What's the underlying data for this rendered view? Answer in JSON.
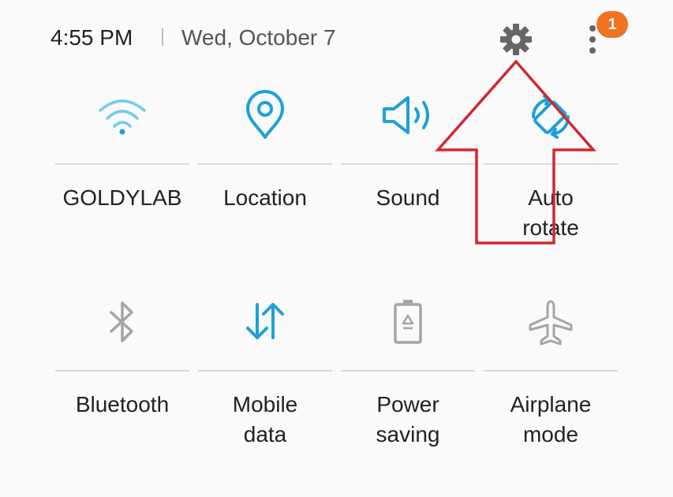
{
  "status": {
    "time": "4:55 PM",
    "date": "Wed, October 7",
    "notification_count": "1",
    "settings_icon": "gear-icon",
    "menu_icon": "more-vertical-icon"
  },
  "colors": {
    "active": "#1ea0d8",
    "inactive": "#a5a5a5",
    "badge": "#ef7320",
    "annotation": "#d0282e"
  },
  "tiles": [
    {
      "label": "GOLDYLAB",
      "icon": "wifi-icon",
      "active": true
    },
    {
      "label": "Location",
      "icon": "location-icon",
      "active": true
    },
    {
      "label": "Sound",
      "icon": "sound-icon",
      "active": true
    },
    {
      "label": "Auto\nrotate",
      "icon": "auto-rotate-icon",
      "active": true
    },
    {
      "label": "Bluetooth",
      "icon": "bluetooth-icon",
      "active": false
    },
    {
      "label": "Mobile\ndata",
      "icon": "mobile-data-icon",
      "active": true
    },
    {
      "label": "Power\nsaving",
      "icon": "power-saving-icon",
      "active": false
    },
    {
      "label": "Airplane\nmode",
      "icon": "airplane-icon",
      "active": false
    }
  ]
}
